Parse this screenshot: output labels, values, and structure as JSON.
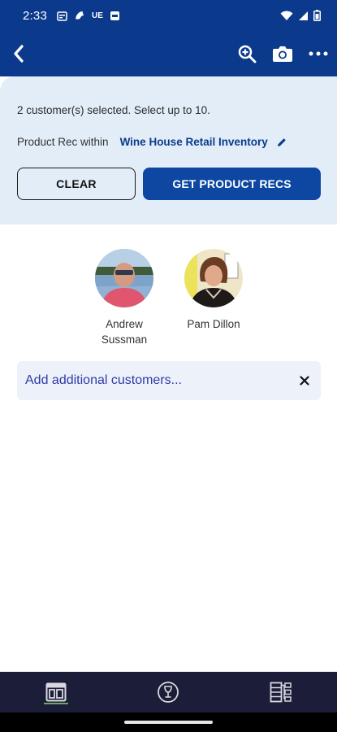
{
  "status_bar": {
    "time": "2:33",
    "notification_label": "UE",
    "icons": [
      "calendar-icon",
      "bird-icon",
      "ue-text",
      "notification-box-icon",
      "wifi-icon",
      "signal-icon",
      "battery-icon"
    ]
  },
  "app_bar": {
    "back_icon": "chevron-left-icon",
    "actions": [
      "zoom-in-icon",
      "camera-icon",
      "more-horiz-icon"
    ]
  },
  "selection": {
    "summary": "2 customer(s) selected. Select up to 10.",
    "rec_prefix": "Product Rec within",
    "store_name": "Wine House Retail Inventory"
  },
  "buttons": {
    "clear_label": "CLEAR",
    "get_recs_label": "GET PRODUCT RECS"
  },
  "customers": [
    {
      "name": "Andrew Sussman"
    },
    {
      "name": "Pam Dillon"
    }
  ],
  "add_customers": {
    "text": "Add additional customers..."
  },
  "bottom_nav": {
    "items": [
      "dashboard-icon",
      "wine-glass-icon",
      "list-tree-icon"
    ],
    "active_index": 0
  },
  "colors": {
    "primary": "#0b3a8c",
    "button_blue": "#0d47a1",
    "panel_bg": "#e2edf8",
    "nav_bg": "#1c1d38",
    "active_underline": "#6ea56a",
    "link_text": "#2f3aa8"
  }
}
